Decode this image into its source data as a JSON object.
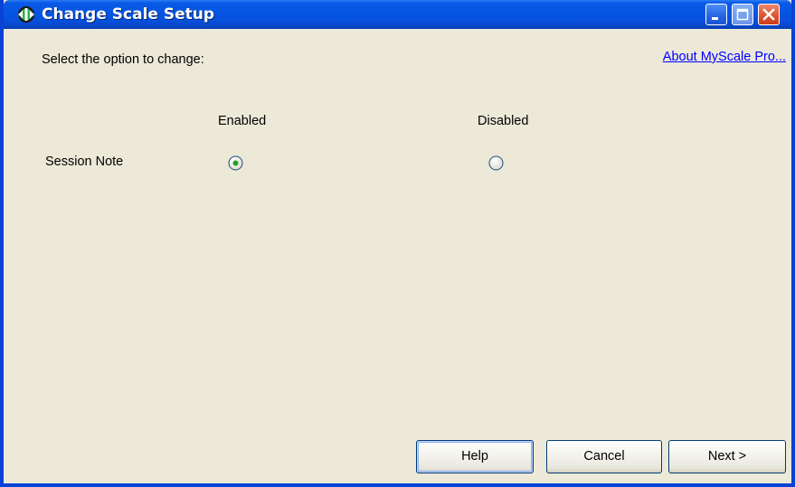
{
  "window": {
    "title": "Change Scale Setup",
    "icon": "myscale-app-icon"
  },
  "titlebar_buttons": {
    "minimize": "minimize-icon",
    "maximize": "maximize-icon",
    "close": "close-icon"
  },
  "content": {
    "instruction": "Select the option to change:",
    "about_link": "About MyScale Pro...",
    "columns": {
      "enabled": "Enabled",
      "disabled": "Disabled"
    },
    "rows": [
      {
        "label": "Session Note",
        "selected": "enabled"
      }
    ]
  },
  "buttons": {
    "help": "Help",
    "cancel": "Cancel",
    "next": "Next >"
  },
  "colors": {
    "titlebar": "#0654e2",
    "dialog_background": "#ece9d8",
    "link": "#0000ff",
    "radio_dot": "#21a121",
    "close_button": "#e0542f"
  }
}
